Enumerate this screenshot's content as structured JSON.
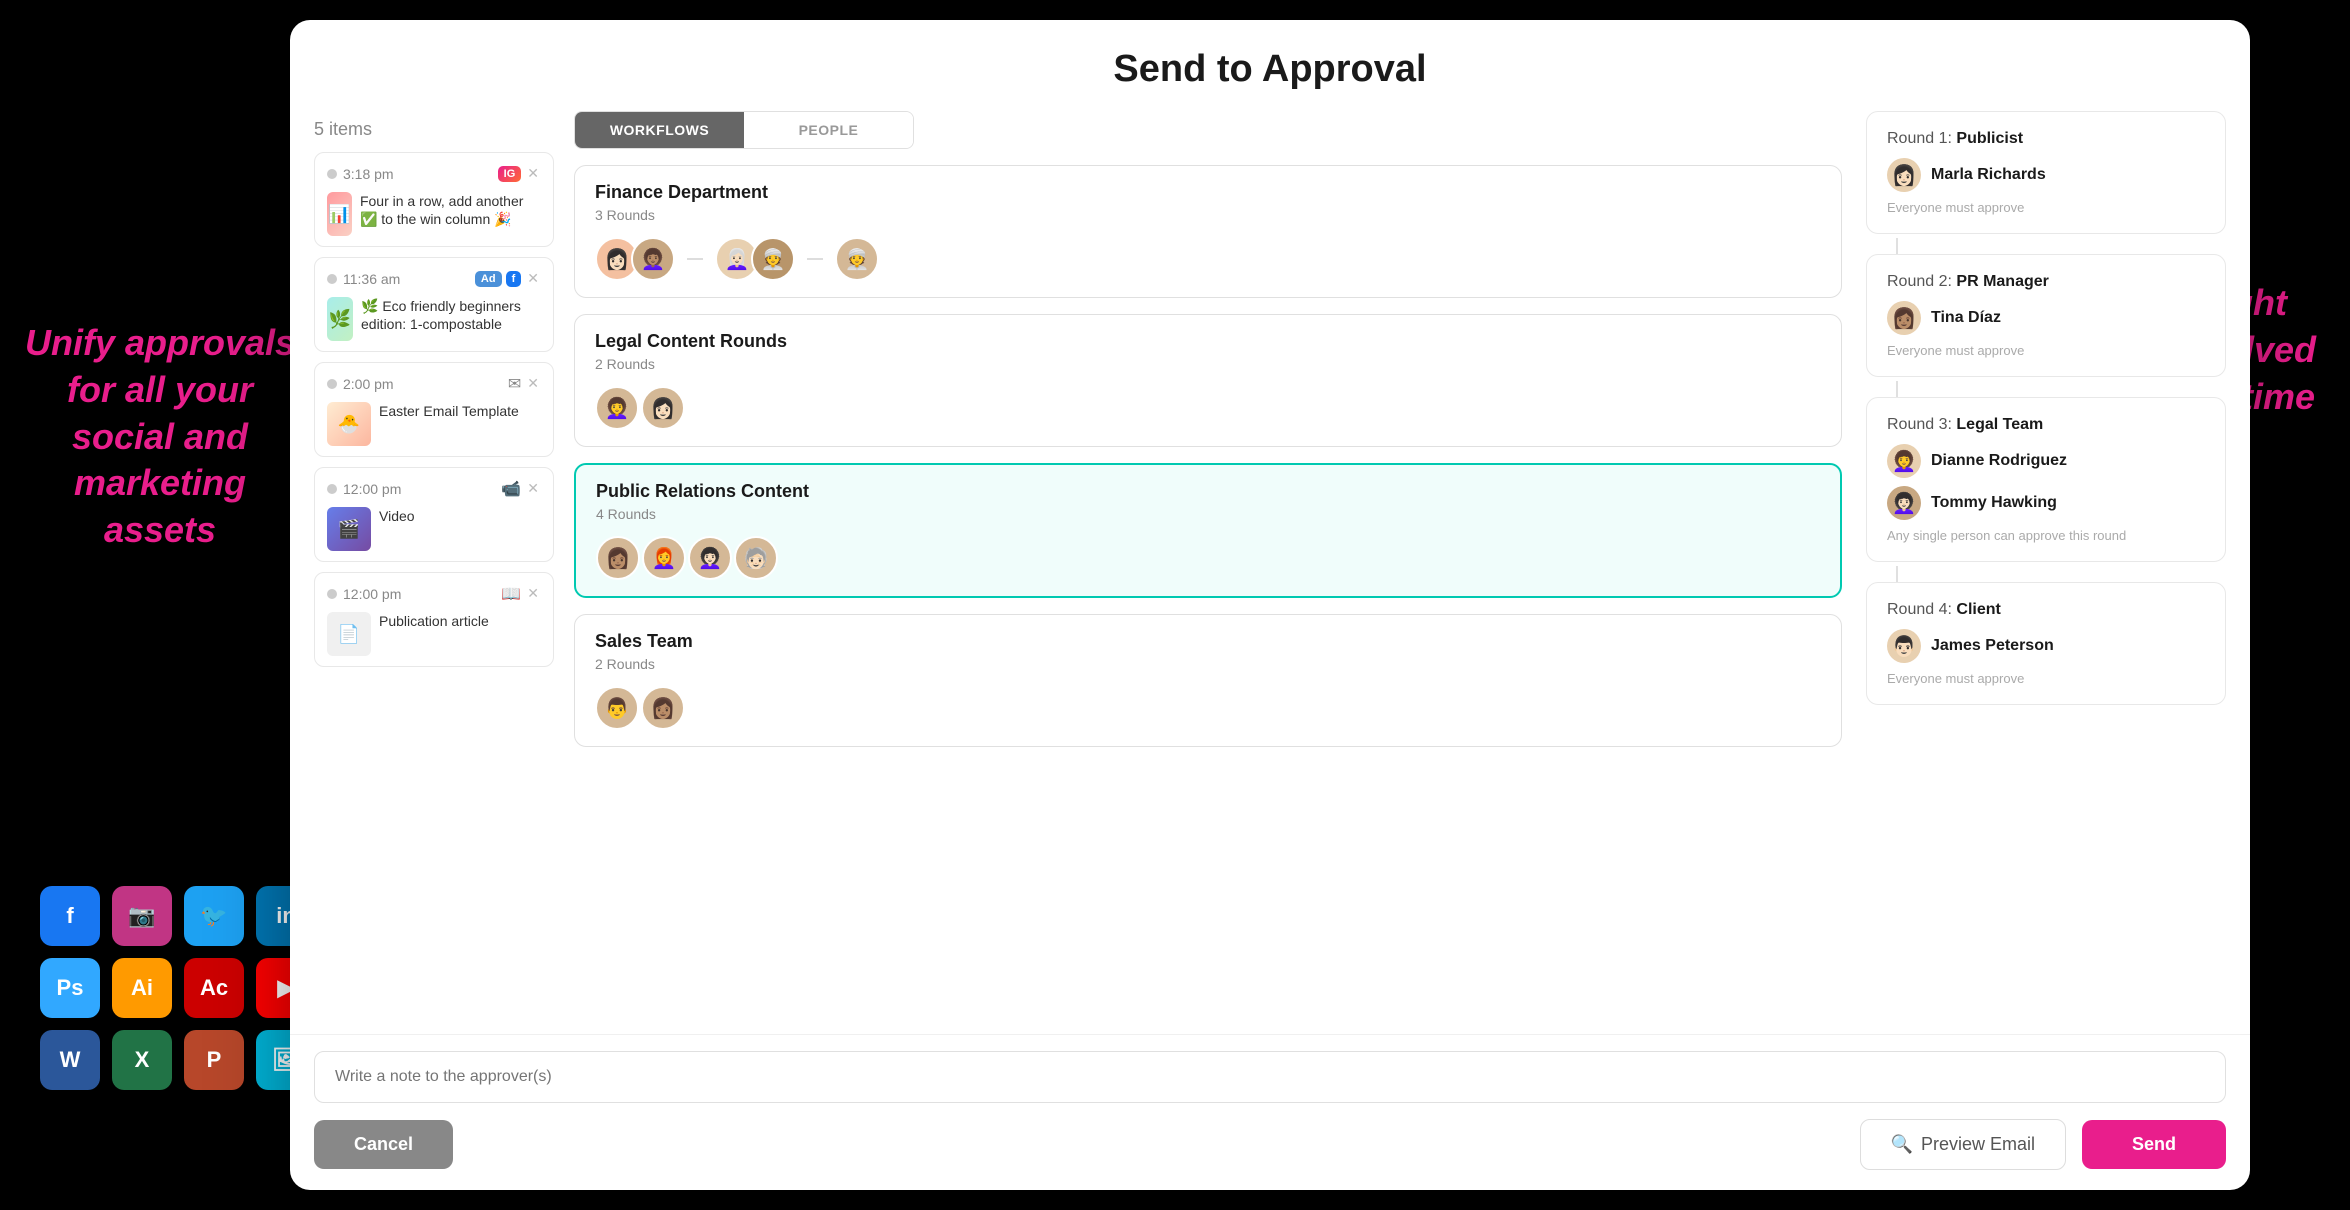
{
  "modal": {
    "title": "Send to Approval",
    "items_count": "5 items"
  },
  "annotation_left": "Unify approvals for all your social and marketing assets",
  "annotation_right": "Get the right people involved at the right time",
  "tabs": {
    "workflows_label": "WORKFLOWS",
    "people_label": "PEOPLE"
  },
  "items": [
    {
      "time": "3:18 pm",
      "badges": [
        "IG"
      ],
      "text": "Four in a row, add another ✅ to the win column 🎉",
      "thumb_class": "thumb-social",
      "icon": ""
    },
    {
      "time": "11:36 am",
      "badges": [
        "Ad",
        "f"
      ],
      "text": "🌿 Eco friendly beginners edition: 1-compostable",
      "thumb_class": "thumb-eco",
      "icon": ""
    },
    {
      "time": "2:00 pm",
      "badges": [],
      "text": "Easter Email Template",
      "thumb_class": "thumb-easter",
      "icon": "✉"
    },
    {
      "time": "12:00 pm",
      "badges": [],
      "text": "Video",
      "thumb_class": "thumb-video",
      "icon": "📹"
    },
    {
      "time": "12:00 pm",
      "badges": [],
      "text": "Publication article",
      "thumb_class": "thumb-pub",
      "icon": "📖"
    }
  ],
  "workflows": [
    {
      "name": "Finance Department",
      "rounds": "3 Rounds",
      "selected": false,
      "avatars": [
        "👩",
        "👩🏽‍🦱",
        "👩🏻‍🦳",
        "👳"
      ]
    },
    {
      "name": "Legal Content Rounds",
      "rounds": "2 Rounds",
      "selected": false,
      "avatars": [
        "👩‍🦱",
        "👩🏻"
      ]
    },
    {
      "name": "Public Relations Content",
      "rounds": "4 Rounds",
      "selected": true,
      "avatars": [
        "👩🏽",
        "👩‍🦰",
        "👩🏻‍🦱",
        "🧓🏻"
      ]
    },
    {
      "name": "Sales Team",
      "rounds": "2 Rounds",
      "selected": false,
      "avatars": [
        "👨",
        "👩🏽"
      ]
    }
  ],
  "rounds": [
    {
      "label": "Round 1:",
      "role": "Publicist",
      "person_name": "Marla Richards",
      "rule": "Everyone must approve",
      "avatar_emoji": "👩🏻"
    },
    {
      "label": "Round 2:",
      "role": "PR Manager",
      "person_name": "Tina Díaz",
      "rule": "Everyone must approve",
      "avatar_emoji": "👩🏽"
    },
    {
      "label": "Round 3:",
      "role": "Legal Team",
      "person_name": "Dianne Rodriguez",
      "person2_name": "Tommy Hawking",
      "rule": "Any single person can approve this round",
      "avatar_emoji": "👩‍🦱",
      "avatar2_emoji": "👩🏻‍🦱"
    },
    {
      "label": "Round 4:",
      "role": "Client",
      "person_name": "James Peterson",
      "rule": "Everyone must approve",
      "avatar_emoji": "👨🏻"
    }
  ],
  "footer": {
    "note_placeholder": "Write a note to the approver(s)",
    "cancel_label": "Cancel",
    "preview_label": "Preview Email",
    "send_label": "Send"
  },
  "icons_grid": [
    {
      "emoji": "f",
      "color": "#1877f2",
      "label": "facebook"
    },
    {
      "emoji": "📷",
      "color": "#c13584",
      "label": "instagram"
    },
    {
      "emoji": "🐦",
      "color": "#1da1f2",
      "label": "twitter"
    },
    {
      "emoji": "in",
      "color": "#0077b5",
      "label": "linkedin"
    },
    {
      "emoji": "Ps",
      "color": "#31a8ff",
      "label": "photoshop"
    },
    {
      "emoji": "Ai",
      "color": "#ff9a00",
      "label": "illustrator"
    },
    {
      "emoji": "Ac",
      "color": "#ff0000",
      "label": "acrobat"
    },
    {
      "emoji": "▶",
      "color": "#ff0000",
      "label": "youtube"
    },
    {
      "emoji": "W",
      "color": "#2b579a",
      "label": "word"
    },
    {
      "emoji": "X",
      "color": "#217346",
      "label": "excel"
    },
    {
      "emoji": "P",
      "color": "#b7472a",
      "label": "powerpoint"
    },
    {
      "emoji": "🖼",
      "color": "#00b4d8",
      "label": "image"
    }
  ]
}
